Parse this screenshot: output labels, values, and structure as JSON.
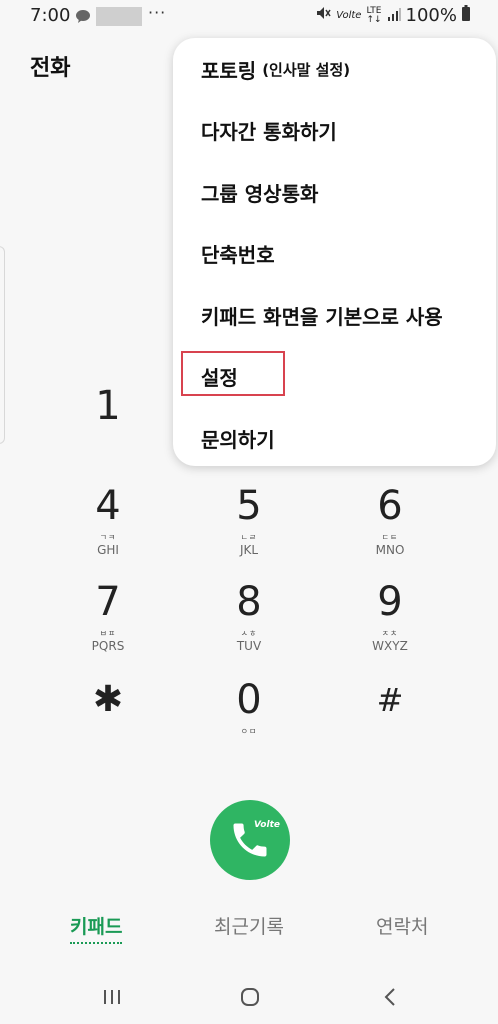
{
  "status_bar": {
    "time": "7:00",
    "talk_label": "TALK",
    "overflow": "···",
    "volte": "Volte",
    "lte_top": "LTE",
    "lte_bottom": "↑↓",
    "battery": "100%"
  },
  "header": {
    "title": "전화"
  },
  "menu": {
    "items": [
      {
        "label": "포토링",
        "sub": "(인사말 설정)"
      },
      {
        "label": "다자간 통화하기"
      },
      {
        "label": "그룹 영상통화"
      },
      {
        "label": "단축번호"
      },
      {
        "label": "키패드 화면을 기본으로 사용"
      },
      {
        "label": "설정"
      },
      {
        "label": "문의하기"
      }
    ]
  },
  "dialpad": {
    "keys": [
      {
        "digit": "1",
        "ko": "",
        "en": ""
      },
      {
        "digit": "4",
        "ko": "ㄱㅋ",
        "en": "GHI"
      },
      {
        "digit": "5",
        "ko": "ㄴㄹ",
        "en": "JKL"
      },
      {
        "digit": "6",
        "ko": "ㄷㅌ",
        "en": "MNO"
      },
      {
        "digit": "7",
        "ko": "ㅂㅍ",
        "en": "PQRS"
      },
      {
        "digit": "8",
        "ko": "ㅅㅎ",
        "en": "TUV"
      },
      {
        "digit": "9",
        "ko": "ㅈㅊ",
        "en": "WXYZ"
      },
      {
        "digit": "✱",
        "ko": "",
        "en": ""
      },
      {
        "digit": "0",
        "ko": "ㅇㅁ",
        "en": ""
      },
      {
        "digit": "#",
        "ko": "",
        "en": ""
      }
    ]
  },
  "call_button": {
    "badge": "Volte",
    "color": "#2fb563"
  },
  "tabs": [
    {
      "label": "키패드",
      "active": true
    },
    {
      "label": "최근기록",
      "active": false
    },
    {
      "label": "연락처",
      "active": false
    }
  ],
  "colors": {
    "accent": "#1a9a55",
    "highlight": "#d8434f"
  }
}
